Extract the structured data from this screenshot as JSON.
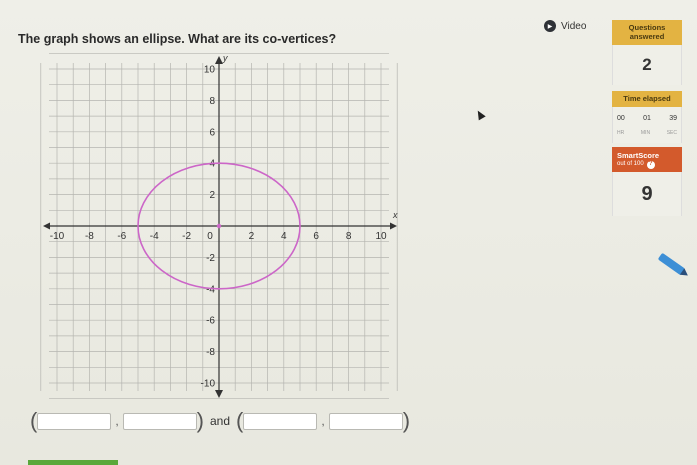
{
  "question": {
    "text": "The graph shows an ellipse. What are its co-vertices?"
  },
  "video": {
    "label": "Video"
  },
  "sidebar": {
    "questions_answered_label": "Questions answered",
    "questions_answered_value": "2",
    "time_elapsed_label": "Time elapsed",
    "time": {
      "hr": "00",
      "min": "01",
      "sec": "39"
    },
    "time_units": {
      "hr": "HR",
      "min": "MIN",
      "sec": "SEC"
    },
    "smartscore_label": "SmartScore",
    "smartscore_sub": "out of 100",
    "smartscore_value": "9"
  },
  "graph": {
    "x_range": [
      -10,
      10
    ],
    "y_range": [
      -10,
      10
    ],
    "x_axis_label": "x",
    "y_axis_label": "y",
    "x_tick_labels": [
      "-10",
      "-8",
      "-6",
      "-4",
      "-2",
      "0",
      "2",
      "4",
      "6",
      "8",
      "10"
    ],
    "y_tick_labels": [
      "10",
      "8",
      "6",
      "4",
      "2",
      "-2",
      "-4",
      "-6",
      "-8",
      "-10"
    ],
    "ellipse": {
      "center": [
        0,
        0
      ],
      "rx": 5,
      "ry": 4,
      "color": "#cc66c8"
    },
    "grid_color": "#b5b5b0",
    "axis_color": "#333333"
  },
  "answer": {
    "and_text": "and",
    "comma": ","
  },
  "colors": {
    "accent": "#e3b342",
    "smartscore": "#d35a2c",
    "pencil": "#3d8fd6"
  }
}
